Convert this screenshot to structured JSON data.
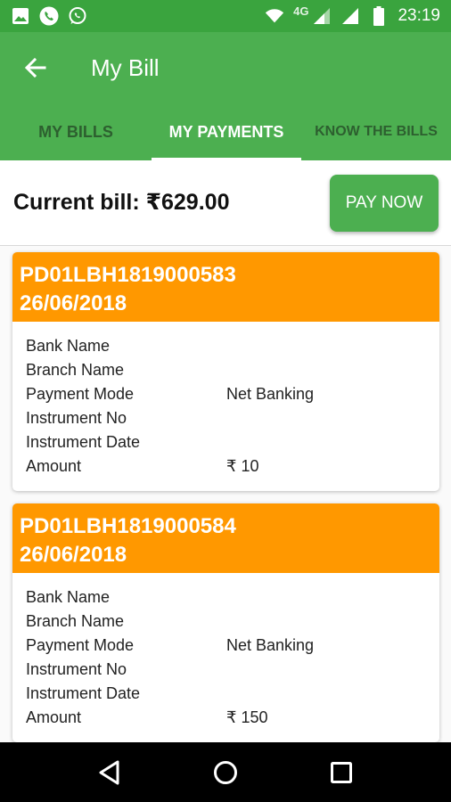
{
  "status_bar": {
    "time": "23:19",
    "network": "4G",
    "icons": [
      "image-icon",
      "phone-icon",
      "whatsapp-icon",
      "wifi-icon",
      "signal-icon",
      "signal-icon",
      "battery-icon"
    ]
  },
  "app_bar": {
    "title": "My Bill",
    "back_icon": "arrow-left-icon"
  },
  "tabs": [
    {
      "label": "MY BILLS",
      "active": false
    },
    {
      "label": "MY PAYMENTS",
      "active": true
    },
    {
      "label": "KNOW THE BILLS",
      "active": false
    }
  ],
  "bill": {
    "current_bill": "Current bill:  ₹629.00",
    "pay_now_label": "PAY NOW"
  },
  "payments": [
    {
      "id": "PD01LBH1819000583",
      "date": "26/06/2018",
      "fields": [
        {
          "label": "Bank Name",
          "value": ""
        },
        {
          "label": "Branch Name",
          "value": ""
        },
        {
          "label": "Payment Mode",
          "value": "Net Banking"
        },
        {
          "label": "Instrument No",
          "value": ""
        },
        {
          "label": "Instrument Date",
          "value": ""
        },
        {
          "label": "Amount",
          "value": "₹ 10"
        }
      ]
    },
    {
      "id": "PD01LBH1819000584",
      "date": "26/06/2018",
      "fields": [
        {
          "label": "Bank Name",
          "value": ""
        },
        {
          "label": "Branch Name",
          "value": ""
        },
        {
          "label": "Payment Mode",
          "value": "Net Banking"
        },
        {
          "label": "Instrument No",
          "value": ""
        },
        {
          "label": "Instrument Date",
          "value": ""
        },
        {
          "label": "Amount",
          "value": "₹ 150"
        }
      ]
    }
  ],
  "nav_bar": {
    "icons": [
      "back-triangle-icon",
      "home-circle-icon",
      "recents-square-icon"
    ]
  },
  "colors": {
    "status_bar": "#3aa43e",
    "primary": "#4caf50",
    "accent": "#ff9800",
    "nav_bar": "#000000"
  }
}
